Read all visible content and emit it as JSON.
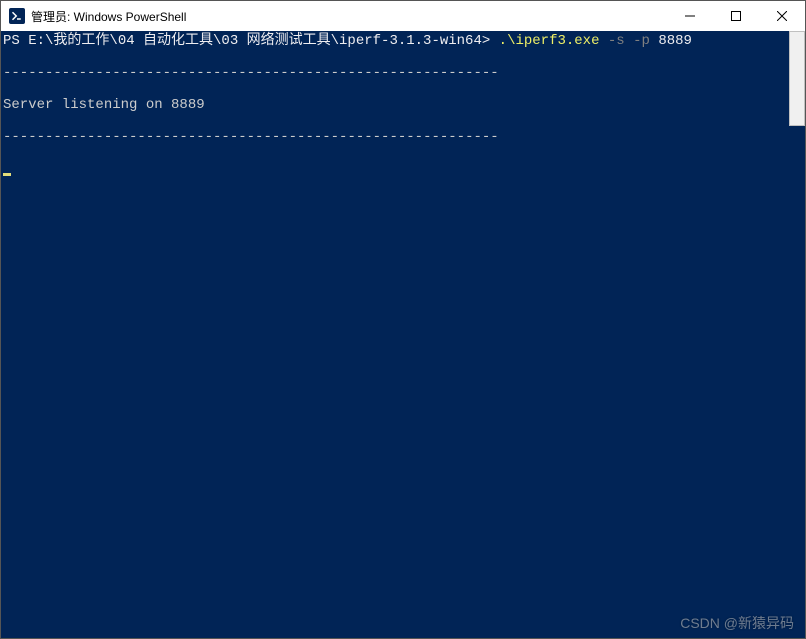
{
  "window": {
    "title": "管理员: Windows PowerShell"
  },
  "terminal": {
    "prompt_prefix": "PS ",
    "prompt_path": "E:\\我的工作\\04 自动化工具\\03 网络测试工具\\iperf-3.1.3-win64",
    "prompt_suffix": "> ",
    "command_exe": ".\\iperf3.exe",
    "command_flags": " -s -p ",
    "command_port": "8889",
    "divider": "-----------------------------------------------------------",
    "listening_text": "Server listening on 8889"
  },
  "watermark": "CSDN @新猿异码"
}
